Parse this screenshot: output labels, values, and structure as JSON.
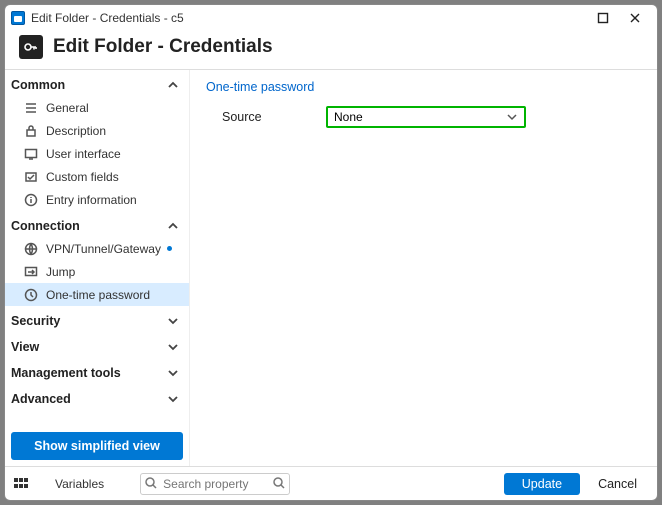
{
  "title": "Edit Folder - Credentials - c5",
  "header": "Edit Folder - Credentials",
  "sidebar": {
    "sections": [
      {
        "label": "Common",
        "expanded": true,
        "items": [
          {
            "label": "General"
          },
          {
            "label": "Description"
          },
          {
            "label": "User interface"
          },
          {
            "label": "Custom fields"
          },
          {
            "label": "Entry information"
          }
        ]
      },
      {
        "label": "Connection",
        "expanded": true,
        "items": [
          {
            "label": "VPN/Tunnel/Gateway",
            "dot": true
          },
          {
            "label": "Jump"
          },
          {
            "label": "One-time password",
            "selected": true
          }
        ]
      },
      {
        "label": "Security",
        "expanded": false
      },
      {
        "label": "View",
        "expanded": false
      },
      {
        "label": "Management tools",
        "expanded": false
      },
      {
        "label": "Advanced",
        "expanded": false
      }
    ],
    "simplified": "Show simplified view"
  },
  "main": {
    "section_title": "One-time password",
    "source_label": "Source",
    "source_value": "None"
  },
  "footer": {
    "variables": "Variables",
    "search_placeholder": "Search property",
    "update": "Update",
    "cancel": "Cancel"
  }
}
